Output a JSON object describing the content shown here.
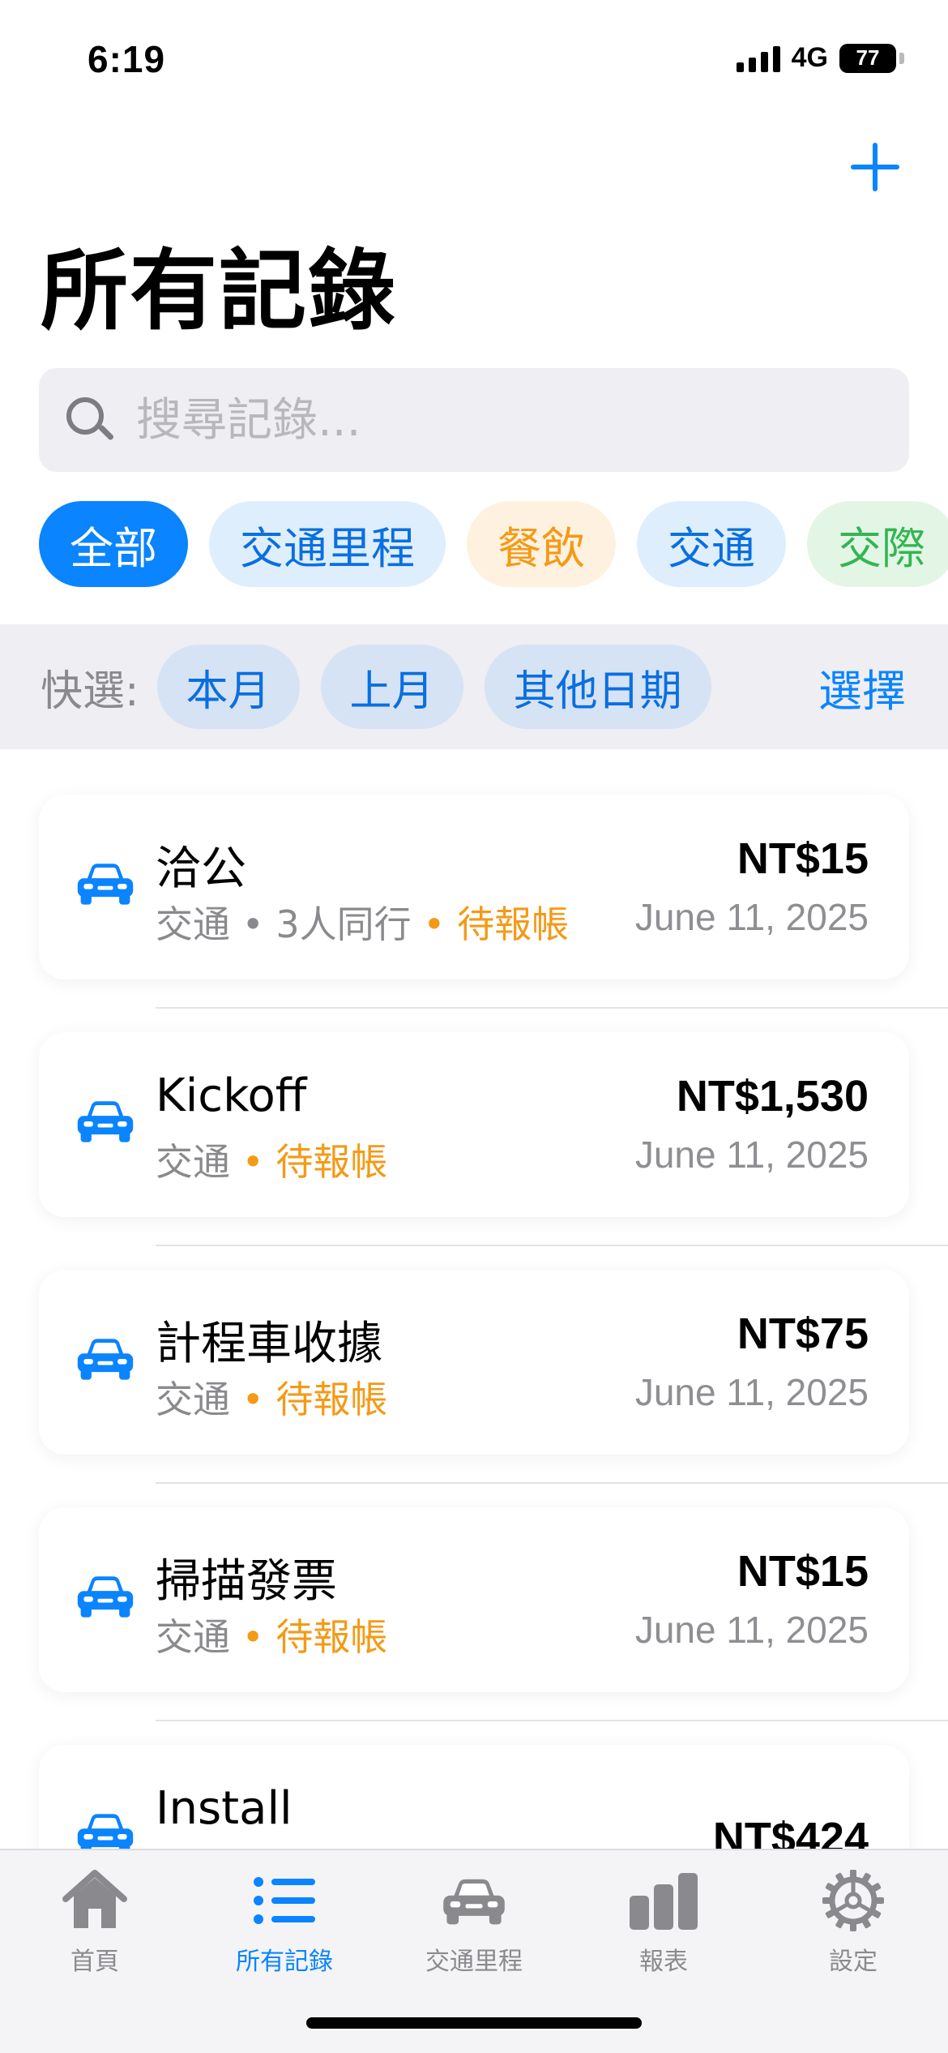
{
  "status": {
    "time": "6:19",
    "network": "4G",
    "battery": "77"
  },
  "header": {
    "title": "所有記錄"
  },
  "search": {
    "placeholder": "搜尋記錄..."
  },
  "categories": [
    {
      "label": "全部",
      "bg": "#0a84ff",
      "fg": "#ffffff"
    },
    {
      "label": "交通里程",
      "bg": "#dfeefc",
      "fg": "#0a6fe0"
    },
    {
      "label": "餐飲",
      "bg": "#fff1df",
      "fg": "#f39a17"
    },
    {
      "label": "交通",
      "bg": "#dfeefc",
      "fg": "#0a6fe0"
    },
    {
      "label": "交際",
      "bg": "#e3f6e6",
      "fg": "#34b552"
    }
  ],
  "quick_select": {
    "label": "快選:",
    "options": [
      "本月",
      "上月",
      "其他日期"
    ],
    "choose": "選擇"
  },
  "records": [
    {
      "title": "洽公",
      "category": "交通",
      "extra": "3人同行",
      "status": "待報帳",
      "amount": "NT$15",
      "date": "June 11, 2025"
    },
    {
      "title": "Kickoff",
      "category": "交通",
      "extra": "",
      "status": "待報帳",
      "amount": "NT$1,530",
      "date": "June 11, 2025"
    },
    {
      "title": "計程車收據",
      "category": "交通",
      "extra": "",
      "status": "待報帳",
      "amount": "NT$75",
      "date": "June 11, 2025"
    },
    {
      "title": "掃描發票",
      "category": "交通",
      "extra": "",
      "status": "待報帳",
      "amount": "NT$15",
      "date": "June 11, 2025"
    },
    {
      "title": "Install",
      "category": "",
      "extra": "",
      "status": "",
      "amount": "NT$424",
      "date": ""
    }
  ],
  "tabs": [
    {
      "label": "首頁",
      "icon": "house-icon",
      "active": false
    },
    {
      "label": "所有記錄",
      "icon": "list-icon",
      "active": true
    },
    {
      "label": "交通里程",
      "icon": "car-icon",
      "active": false
    },
    {
      "label": "報表",
      "icon": "bar-chart-icon",
      "active": false
    },
    {
      "label": "設定",
      "icon": "gear-icon",
      "active": false
    }
  ],
  "colors": {
    "accent": "#0a84ff",
    "pending": "#f39a17",
    "secondary_text": "#8a8a8e"
  }
}
